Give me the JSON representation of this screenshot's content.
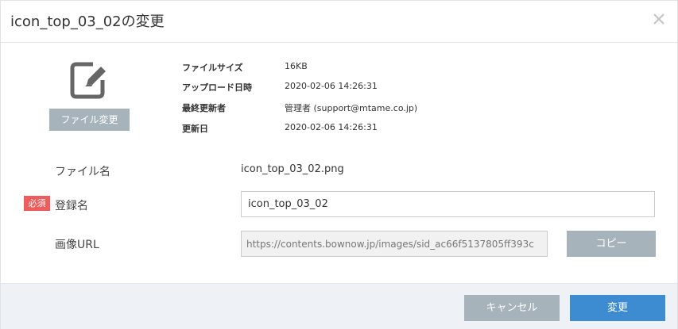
{
  "dialog": {
    "title": "icon_top_03_02の変更",
    "close_icon": "close-icon"
  },
  "file_info": {
    "icon": "edit-document-icon",
    "change_button_label": "ファイル変更",
    "meta": [
      {
        "label": "ファイルサイズ",
        "value": "16KB"
      },
      {
        "label": "アップロード日時",
        "value": "2020-02-06 14:26:31"
      },
      {
        "label": "最終更新者",
        "value": "管理者 (support@mtame.co.jp)"
      },
      {
        "label": "更新日",
        "value": "2020-02-06 14:26:31"
      }
    ]
  },
  "form": {
    "filename_label": "ファイル名",
    "filename_value": "icon_top_03_02.png",
    "required_badge": "必須",
    "name_label": "登録名",
    "name_value": "icon_top_03_02",
    "url_label": "画像URL",
    "url_value": "https://contents.bownow.jp/images/sid_ac66f5137805ff393c",
    "copy_button_label": "コピー"
  },
  "footer": {
    "cancel_label": "キャンセル",
    "submit_label": "変更"
  },
  "colors": {
    "gray_button": "#a7b3bb",
    "primary_button": "#3d8bd0",
    "required_badge": "#ee5c5c",
    "footer_bg": "#eef1f6"
  }
}
